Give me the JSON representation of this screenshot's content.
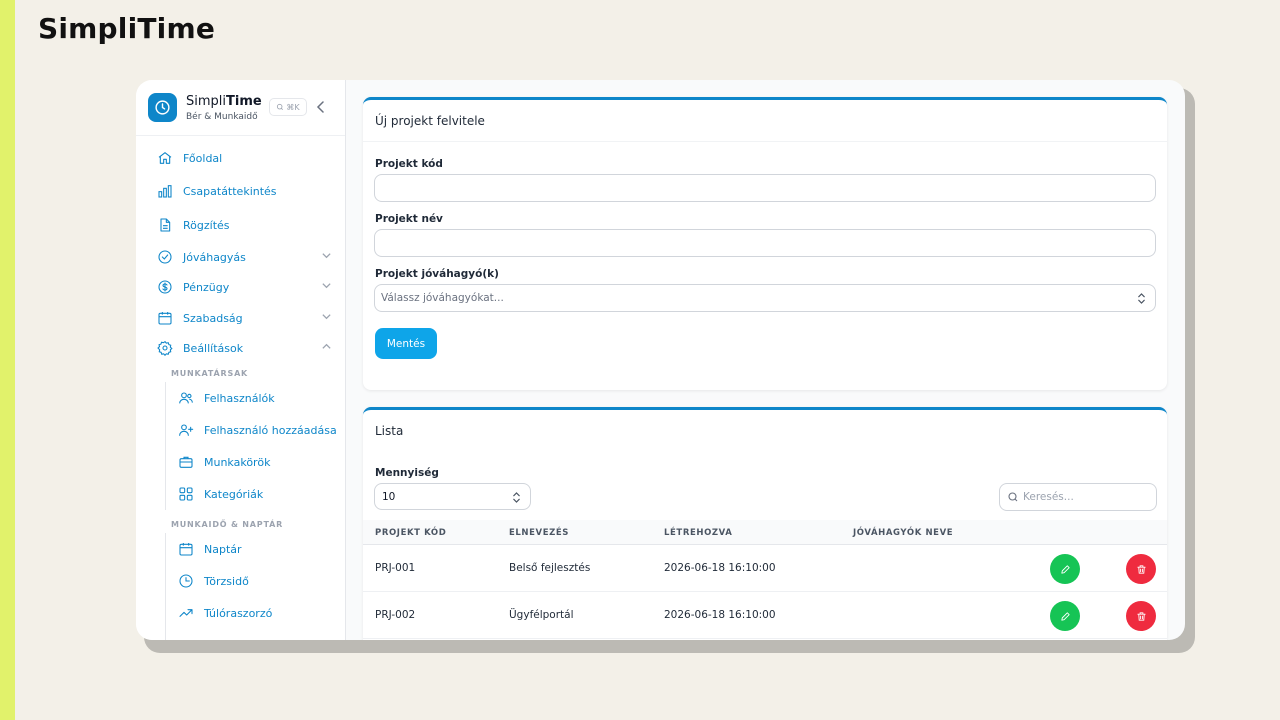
{
  "page_title": "SimpliTime",
  "brand": {
    "name_plain": "Simpli",
    "name_bold": "Time",
    "subtitle": "Bér & Munkaidő",
    "shortcut": "⌘K"
  },
  "nav": [
    {
      "label": "Főoldal",
      "icon": "home-icon"
    },
    {
      "label": "Csapatáttekintés",
      "icon": "bar-chart-icon"
    },
    {
      "label": "Rögzítés",
      "icon": "document-icon"
    },
    {
      "label": "Jóváhagyás",
      "icon": "check-circle-icon",
      "expandable": true
    },
    {
      "label": "Pénzügy",
      "icon": "dollar-circle-icon",
      "expandable": true
    },
    {
      "label": "Szabadság",
      "icon": "calendar-icon",
      "expandable": true
    },
    {
      "label": "Beállítások",
      "icon": "gear-icon",
      "expanded": true
    }
  ],
  "settings_sections": [
    {
      "title": "MUNKATÁRSAK",
      "items": [
        {
          "label": "Felhasználók",
          "icon": "users-icon"
        },
        {
          "label": "Felhasználó hozzáadása",
          "icon": "user-plus-icon"
        },
        {
          "label": "Munkakörök",
          "icon": "briefcase-icon"
        },
        {
          "label": "Kategóriák",
          "icon": "grid-icon"
        }
      ]
    },
    {
      "title": "MUNKAIDŐ & NAPTÁR",
      "items": [
        {
          "label": "Naptár",
          "icon": "calendar-icon"
        },
        {
          "label": "Törzsidő",
          "icon": "clock-icon"
        },
        {
          "label": "Túlóraszorzó",
          "icon": "trending-up-icon"
        }
      ]
    }
  ],
  "form": {
    "title": "Új projekt felvitele",
    "code_label": "Projekt kód",
    "code_value": "",
    "name_label": "Projekt név",
    "name_value": "",
    "approvers_label": "Projekt jóváhagyó(k)",
    "approvers_placeholder": "Válassz jóváhagyókat...",
    "save_label": "Mentés"
  },
  "list": {
    "title": "Lista",
    "quantity_label": "Mennyiség",
    "quantity_value": "10",
    "search_placeholder": "Keresés...",
    "columns": [
      "PROJEKT KÓD",
      "ELNEVEZÉS",
      "LÉTREHOZVA",
      "JÓVÁHAGYÓK NEVE"
    ],
    "rows": [
      {
        "code": "PRJ-001",
        "name": "Belső fejlesztés",
        "created": "2026-06-18 16:10:00",
        "approvers": ""
      },
      {
        "code": "PRJ-002",
        "name": "Ügyfélportál",
        "created": "2026-06-18 16:10:00",
        "approvers": ""
      }
    ]
  },
  "colors": {
    "accent": "#0e86c9",
    "save": "#0ea5e9",
    "edit": "#16c455",
    "delete": "#ef2b3f"
  }
}
